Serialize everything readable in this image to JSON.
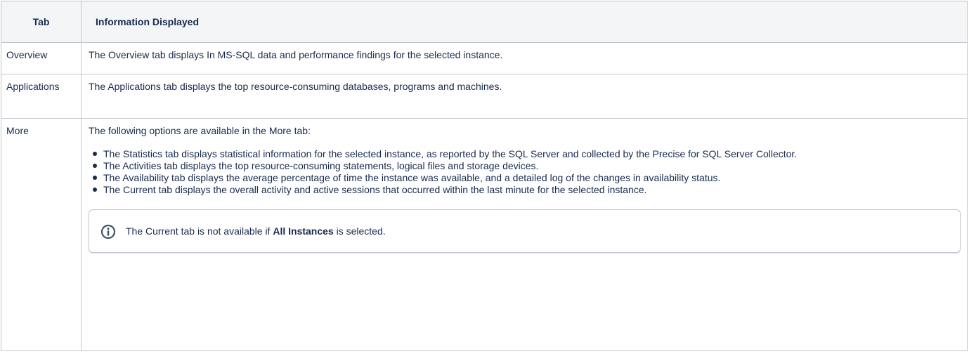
{
  "table": {
    "headers": {
      "tab": "Tab",
      "info": "Information Displayed"
    },
    "rows": [
      {
        "tab": "Overview",
        "info": "The Overview tab displays In MS-SQL data and performance findings for the selected instance."
      },
      {
        "tab": "Applications",
        "info": "The Applications tab displays the top resource-consuming databases, programs and machines."
      },
      {
        "tab": "More",
        "intro": "The following options are available in the More tab:",
        "options": [
          "The Statistics tab displays statistical information for the selected instance, as reported by the SQL Server and collected by the Precise for SQL Server Collector.",
          "The Activities tab displays the top resource-consuming statements, logical files and storage devices.",
          "The Availability tab displays the average percentage of time the instance was available, and a detailed log of the changes in availability status.",
          "The Current tab displays the overall activity and active sessions that occurred within the last minute for the selected instance."
        ],
        "note": {
          "icon": "info-icon",
          "before": "The Current tab is not available if ",
          "bold": "All Instances",
          "after": " is selected."
        }
      }
    ]
  },
  "colors": {
    "border": "#c1c7d0",
    "header_bg": "#f4f5f7",
    "text": "#172b4d",
    "info_icon": "#42526e"
  }
}
